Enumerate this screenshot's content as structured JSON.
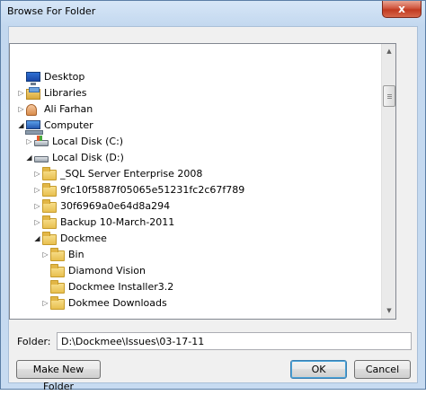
{
  "window": {
    "title": "Browse For Folder",
    "close_label": "x"
  },
  "tree": {
    "items": [
      {
        "label": "Desktop",
        "icon": "desktop-icon",
        "expander": "",
        "indent": 0
      },
      {
        "label": "Libraries",
        "icon": "libraries-icon",
        "expander": "collapsed",
        "indent": 0
      },
      {
        "label": "Ali Farhan",
        "icon": "user-folder-icon",
        "expander": "collapsed",
        "indent": 0
      },
      {
        "label": "Computer",
        "icon": "computer-icon",
        "expander": "expanded",
        "indent": 0
      },
      {
        "label": "Local Disk (C:)",
        "icon": "windows-disk-icon",
        "expander": "collapsed",
        "indent": 1
      },
      {
        "label": "Local Disk (D:)",
        "icon": "disk-icon",
        "expander": "expanded",
        "indent": 1
      },
      {
        "label": "_SQL Server Enterprise 2008",
        "icon": "folder-icon",
        "expander": "collapsed",
        "indent": 2
      },
      {
        "label": "9fc10f5887f05065e51231fc2c67f789",
        "icon": "folder-icon",
        "expander": "collapsed",
        "indent": 2
      },
      {
        "label": "30f6969a0e64d8a294",
        "icon": "folder-icon",
        "expander": "collapsed",
        "indent": 2
      },
      {
        "label": "Backup 10-March-2011",
        "icon": "folder-icon",
        "expander": "collapsed",
        "indent": 2
      },
      {
        "label": "Dockmee",
        "icon": "folder-icon",
        "expander": "expanded",
        "indent": 2
      },
      {
        "label": "Bin",
        "icon": "folder-icon",
        "expander": "collapsed",
        "indent": 3
      },
      {
        "label": "Diamond Vision",
        "icon": "folder-icon",
        "expander": "",
        "indent": 3
      },
      {
        "label": "Dockmee Installer3.2",
        "icon": "folder-icon",
        "expander": "",
        "indent": 3
      },
      {
        "label": "Dokmee Downloads",
        "icon": "folder-icon",
        "expander": "collapsed",
        "indent": 3
      }
    ]
  },
  "folder": {
    "label": "Folder:",
    "value": "D:\\Dockmee\\Issues\\03-17-11"
  },
  "buttons": {
    "make_new_folder": "Make New Folder",
    "ok": "OK",
    "cancel": "Cancel"
  }
}
